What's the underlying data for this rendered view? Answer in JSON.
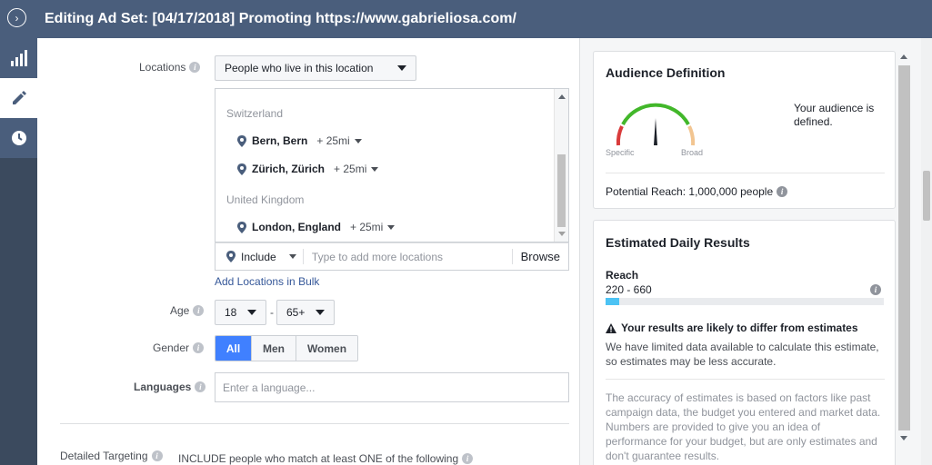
{
  "header": {
    "title": "Editing Ad Set: [04/17/2018] Promoting https://www.gabrieliosa.com/",
    "toggle_icon": "chevron-circle-right-icon"
  },
  "leftnav": {
    "items": [
      {
        "icon": "bar-chart-icon"
      },
      {
        "icon": "pencil-icon"
      },
      {
        "icon": "clock-icon"
      }
    ]
  },
  "form": {
    "locations": {
      "label": "Locations",
      "type_select": "People who live in this location",
      "groups": [
        {
          "country": "Switzerland",
          "items": [
            {
              "name": "Bern, Bern",
              "radius": "+ 25mi"
            },
            {
              "name": "Zürich, Zürich",
              "radius": "+ 25mi"
            }
          ]
        },
        {
          "country": "United Kingdom",
          "items": [
            {
              "name": "London, England",
              "radius": "+ 25mi"
            }
          ]
        }
      ],
      "include_select": "Include",
      "search_placeholder": "Type to add more locations",
      "browse_label": "Browse",
      "bulk_link": "Add Locations in Bulk"
    },
    "age": {
      "label": "Age",
      "min": "18",
      "separator": "-",
      "max": "65+"
    },
    "gender": {
      "label": "Gender",
      "options": [
        "All",
        "Men",
        "Women"
      ],
      "selected": "All"
    },
    "languages": {
      "label": "Languages",
      "placeholder": "Enter a language..."
    },
    "detailed_targeting": {
      "label": "Detailed Targeting",
      "description": "INCLUDE people who match at least ONE of the following"
    }
  },
  "audience_definition": {
    "title": "Audience Definition",
    "gauge_left": "Specific",
    "gauge_right": "Broad",
    "status": "Your audience is defined.",
    "potential_reach": "Potential Reach: 1,000,000 people"
  },
  "daily_results": {
    "title": "Estimated Daily Results",
    "reach_label": "Reach",
    "reach_value": "220 - 660",
    "reach_fill_fraction": 0.05,
    "warning_title": "Your results are likely to differ from estimates",
    "warning_body": "We have limited data available to calculate this estimate, so estimates may be less accurate.",
    "disclaimer": "The accuracy of estimates is based on factors like past campaign data, the budget you entered and market data. Numbers are provided to give you an idea of performance for your budget, but are only estimates and don't guarantee results."
  },
  "colors": {
    "topbar": "#4a5e7c",
    "nav": "#3b4a5e",
    "accent": "#4080ff",
    "link": "#365899",
    "reach_bar": "#4cc3f4",
    "gauge_green": "#42b72a",
    "gauge_red": "#d93b3b",
    "gauge_tan": "#f2c591"
  }
}
